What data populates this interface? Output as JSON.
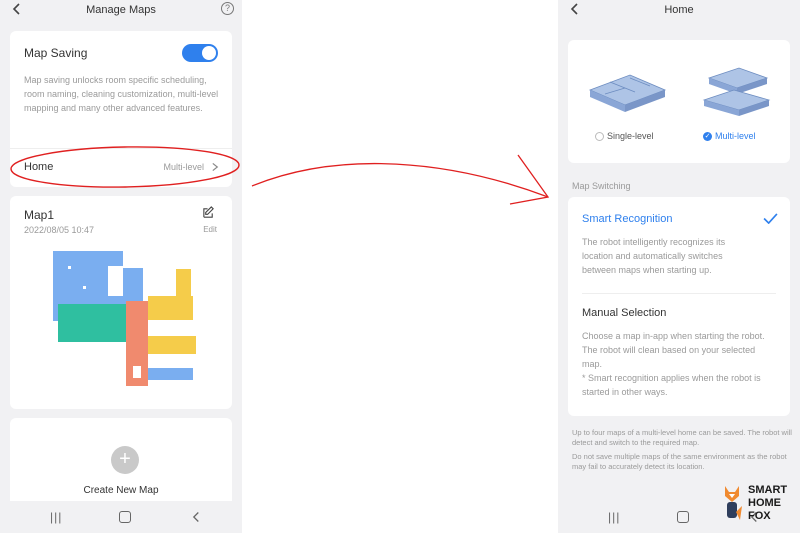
{
  "left": {
    "title": "Manage Maps",
    "help": "?",
    "map_saving": {
      "label": "Map Saving",
      "description": "Map saving unlocks room specific scheduling, room naming, cleaning customization, multi-level mapping and many other advanced features.",
      "enabled": true
    },
    "home_row": {
      "label": "Home",
      "value": "Multi-level"
    },
    "map_card": {
      "name": "Map1",
      "date": "2022/08/05 10:47",
      "edit_label": "Edit"
    },
    "create": {
      "label": "Create New Map"
    }
  },
  "right": {
    "title": "Home",
    "levels": [
      {
        "label": "Single-level",
        "selected": false
      },
      {
        "label": "Multi-level",
        "selected": true
      }
    ],
    "section_title": "Map Switching",
    "options": [
      {
        "title": "Smart Recognition",
        "selected": true,
        "description": "The robot intelligently recognizes its location and automatically switches between maps when starting up."
      },
      {
        "title": "Manual Selection",
        "selected": false,
        "description": "Choose a map in-app when starting the robot. The robot will clean based on your selected map.\n* Smart recognition applies when the robot is started in other ways."
      }
    ],
    "note1": "Up to four maps of a multi-level home can be saved. The robot will detect and switch to the required map.",
    "note2": "Do not save multiple maps of the same environment as the robot may fail to accurately detect its location."
  },
  "logo": {
    "line1": "SMART",
    "line2": "HOME",
    "line3": "FOX"
  },
  "colors": {
    "accent": "#2f80ed",
    "annotation": "#e02020",
    "room_blue": "#7aaef0",
    "room_teal": "#2fbfa0",
    "room_orange": "#f08a6e",
    "room_yellow": "#f5cc4a"
  },
  "icons": [
    "back-arrow-icon",
    "help-icon",
    "chevron-right-icon",
    "edit-icon",
    "plus-icon",
    "check-icon",
    "recents-icon",
    "home-nav-icon",
    "back-nav-icon"
  ]
}
